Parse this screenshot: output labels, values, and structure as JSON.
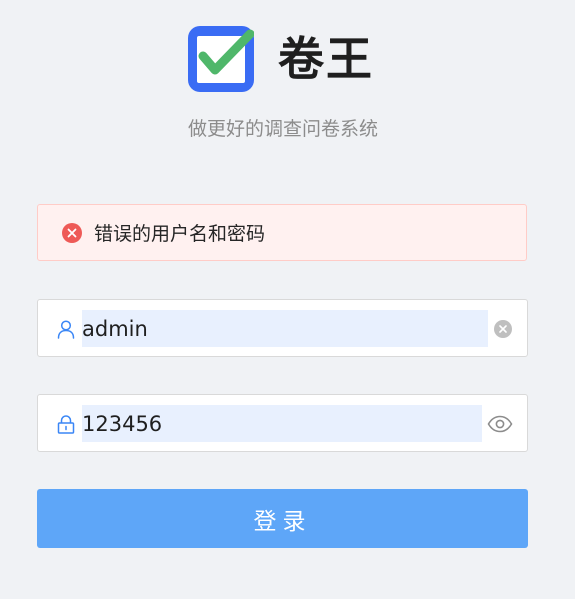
{
  "brand": {
    "logo_icon": "checkbox-check-icon",
    "name": "卷王",
    "subtitle": "做更好的调查问卷系统"
  },
  "alert": {
    "type": "error",
    "icon": "close-circle-icon",
    "message": "错误的用户名和密码"
  },
  "form": {
    "username": {
      "prefix_icon": "user-icon",
      "value": "admin",
      "suffix_icon": "clear-circle-icon"
    },
    "password": {
      "prefix_icon": "lock-icon",
      "value": "123456",
      "suffix_icon": "eye-icon"
    },
    "submit_label": "登录"
  },
  "colors": {
    "primary": "#5ea6f8",
    "logo_blue": "#3a6cf4",
    "logo_check": "#4fb76a",
    "error_red": "#ee5a57",
    "background": "#f0f2f5"
  }
}
